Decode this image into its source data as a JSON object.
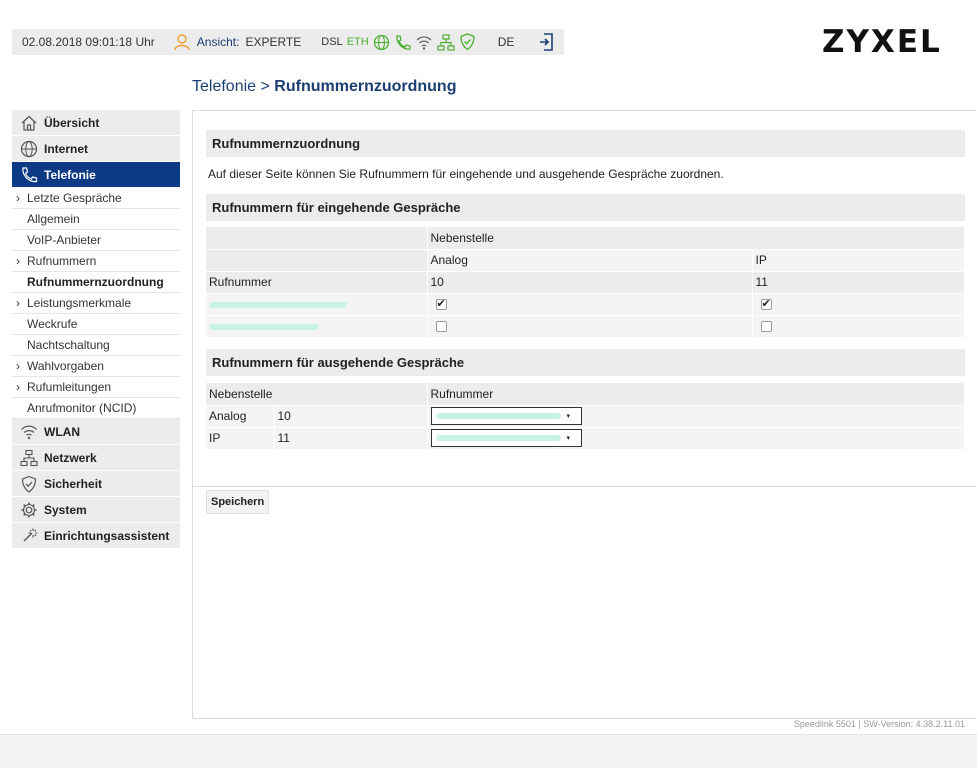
{
  "header": {
    "datetime": "02.08.2018 09:01:18 Uhr",
    "view_label": "Ansicht:",
    "view_value": "EXPERTE",
    "dsl": "DSL",
    "eth": "ETH",
    "language": "DE",
    "brand": "ZYXEL",
    "accent_orange": "#f0a030",
    "accent_green": "#4caf32"
  },
  "breadcrumb": {
    "parent": "Telefonie",
    "sep": " > ",
    "current": "Rufnummernzuordnung"
  },
  "sidebar": {
    "main": [
      {
        "label": "Übersicht",
        "icon": "home-icon"
      },
      {
        "label": "Internet",
        "icon": "globe-icon"
      },
      {
        "label": "Telefonie",
        "icon": "phone-icon",
        "active": true
      }
    ],
    "sub": [
      {
        "label": "Letzte Gespräche",
        "chevron": "›"
      },
      {
        "label": "Allgemein",
        "chevron": ""
      },
      {
        "label": "VoIP-Anbieter",
        "chevron": ""
      },
      {
        "label": "Rufnummern",
        "chevron": "›"
      },
      {
        "label": "Rufnummernzuordnung",
        "chevron": "",
        "selected": true
      },
      {
        "label": "Leistungsmerkmale",
        "chevron": "›"
      },
      {
        "label": "Weckrufe",
        "chevron": ""
      },
      {
        "label": "Nachtschaltung",
        "chevron": ""
      },
      {
        "label": "Wahlvorgaben",
        "chevron": "›"
      },
      {
        "label": "Rufumleitungen",
        "chevron": "›"
      },
      {
        "label": "Anrufmonitor (NCID)",
        "chevron": ""
      }
    ],
    "main2": [
      {
        "label": "WLAN",
        "icon": "wifi-icon"
      },
      {
        "label": "Netzwerk",
        "icon": "network-icon"
      },
      {
        "label": "Sicherheit",
        "icon": "shield-icon"
      },
      {
        "label": "System",
        "icon": "gear-icon"
      },
      {
        "label": "Einrichtungsassistent",
        "icon": "wand-icon"
      }
    ],
    "active_color": "#0c3a85"
  },
  "main": {
    "title": "Rufnummernzuordnung",
    "description": "Auf dieser Seite können Sie Rufnummern für eingehende und ausgehende Gespräche zuordnen.",
    "incoming": {
      "title": "Rufnummern für eingehende Gespräche",
      "group_header": "Nebenstelle",
      "col_analog": "Analog",
      "col_ip": "IP",
      "row_header": "Rufnummer",
      "ext_analog": "10",
      "ext_ip": "11",
      "rows": [
        {
          "analog": true,
          "ip": true
        },
        {
          "analog": false,
          "ip": false
        }
      ]
    },
    "outgoing": {
      "title": "Rufnummern für ausgehende Gespräche",
      "col_ext": "Nebenstelle",
      "col_number": "Rufnummer",
      "rows": [
        {
          "name": "Analog",
          "ext": "10"
        },
        {
          "name": "IP",
          "ext": "11"
        }
      ]
    },
    "save_label": "Speichern"
  },
  "footer": {
    "version": "Speedlink 5501 | SW-Version: 4.38.2.11.01"
  }
}
